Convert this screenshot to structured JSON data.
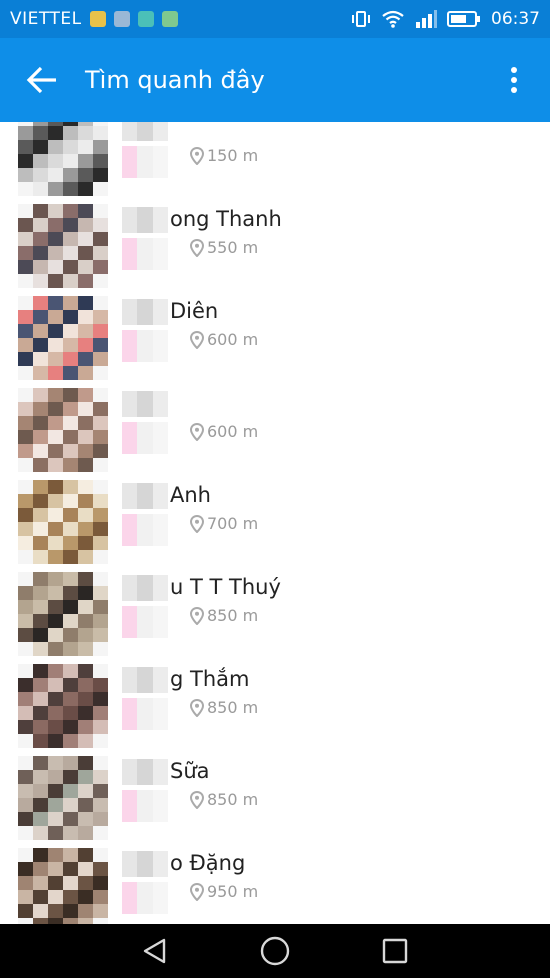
{
  "status_bar": {
    "carrier": "VIETTEL",
    "time": "06:37"
  },
  "app_bar": {
    "title": "Tìm quanh đây"
  },
  "people": [
    {
      "name": "",
      "distance": "150 m"
    },
    {
      "name": "ong Thanh",
      "distance": "550 m"
    },
    {
      "name": "Diên",
      "distance": "600 m"
    },
    {
      "name": "",
      "distance": "600 m"
    },
    {
      "name": "Anh",
      "distance": "700 m"
    },
    {
      "name": "u T T Thuý",
      "distance": "850 m"
    },
    {
      "name": "g Thắm",
      "distance": "850 m"
    },
    {
      "name": "Sữa",
      "distance": "850 m"
    },
    {
      "name": "o Đặng",
      "distance": "950 m"
    }
  ],
  "colors": {
    "status_bar": "#0a7fd6",
    "app_bar": "#0e8ee8",
    "distance_text": "#9a9a9a"
  },
  "icons": {
    "back": "arrow-left-icon",
    "more": "more-vertical-icon",
    "location": "location-pin-icon"
  }
}
